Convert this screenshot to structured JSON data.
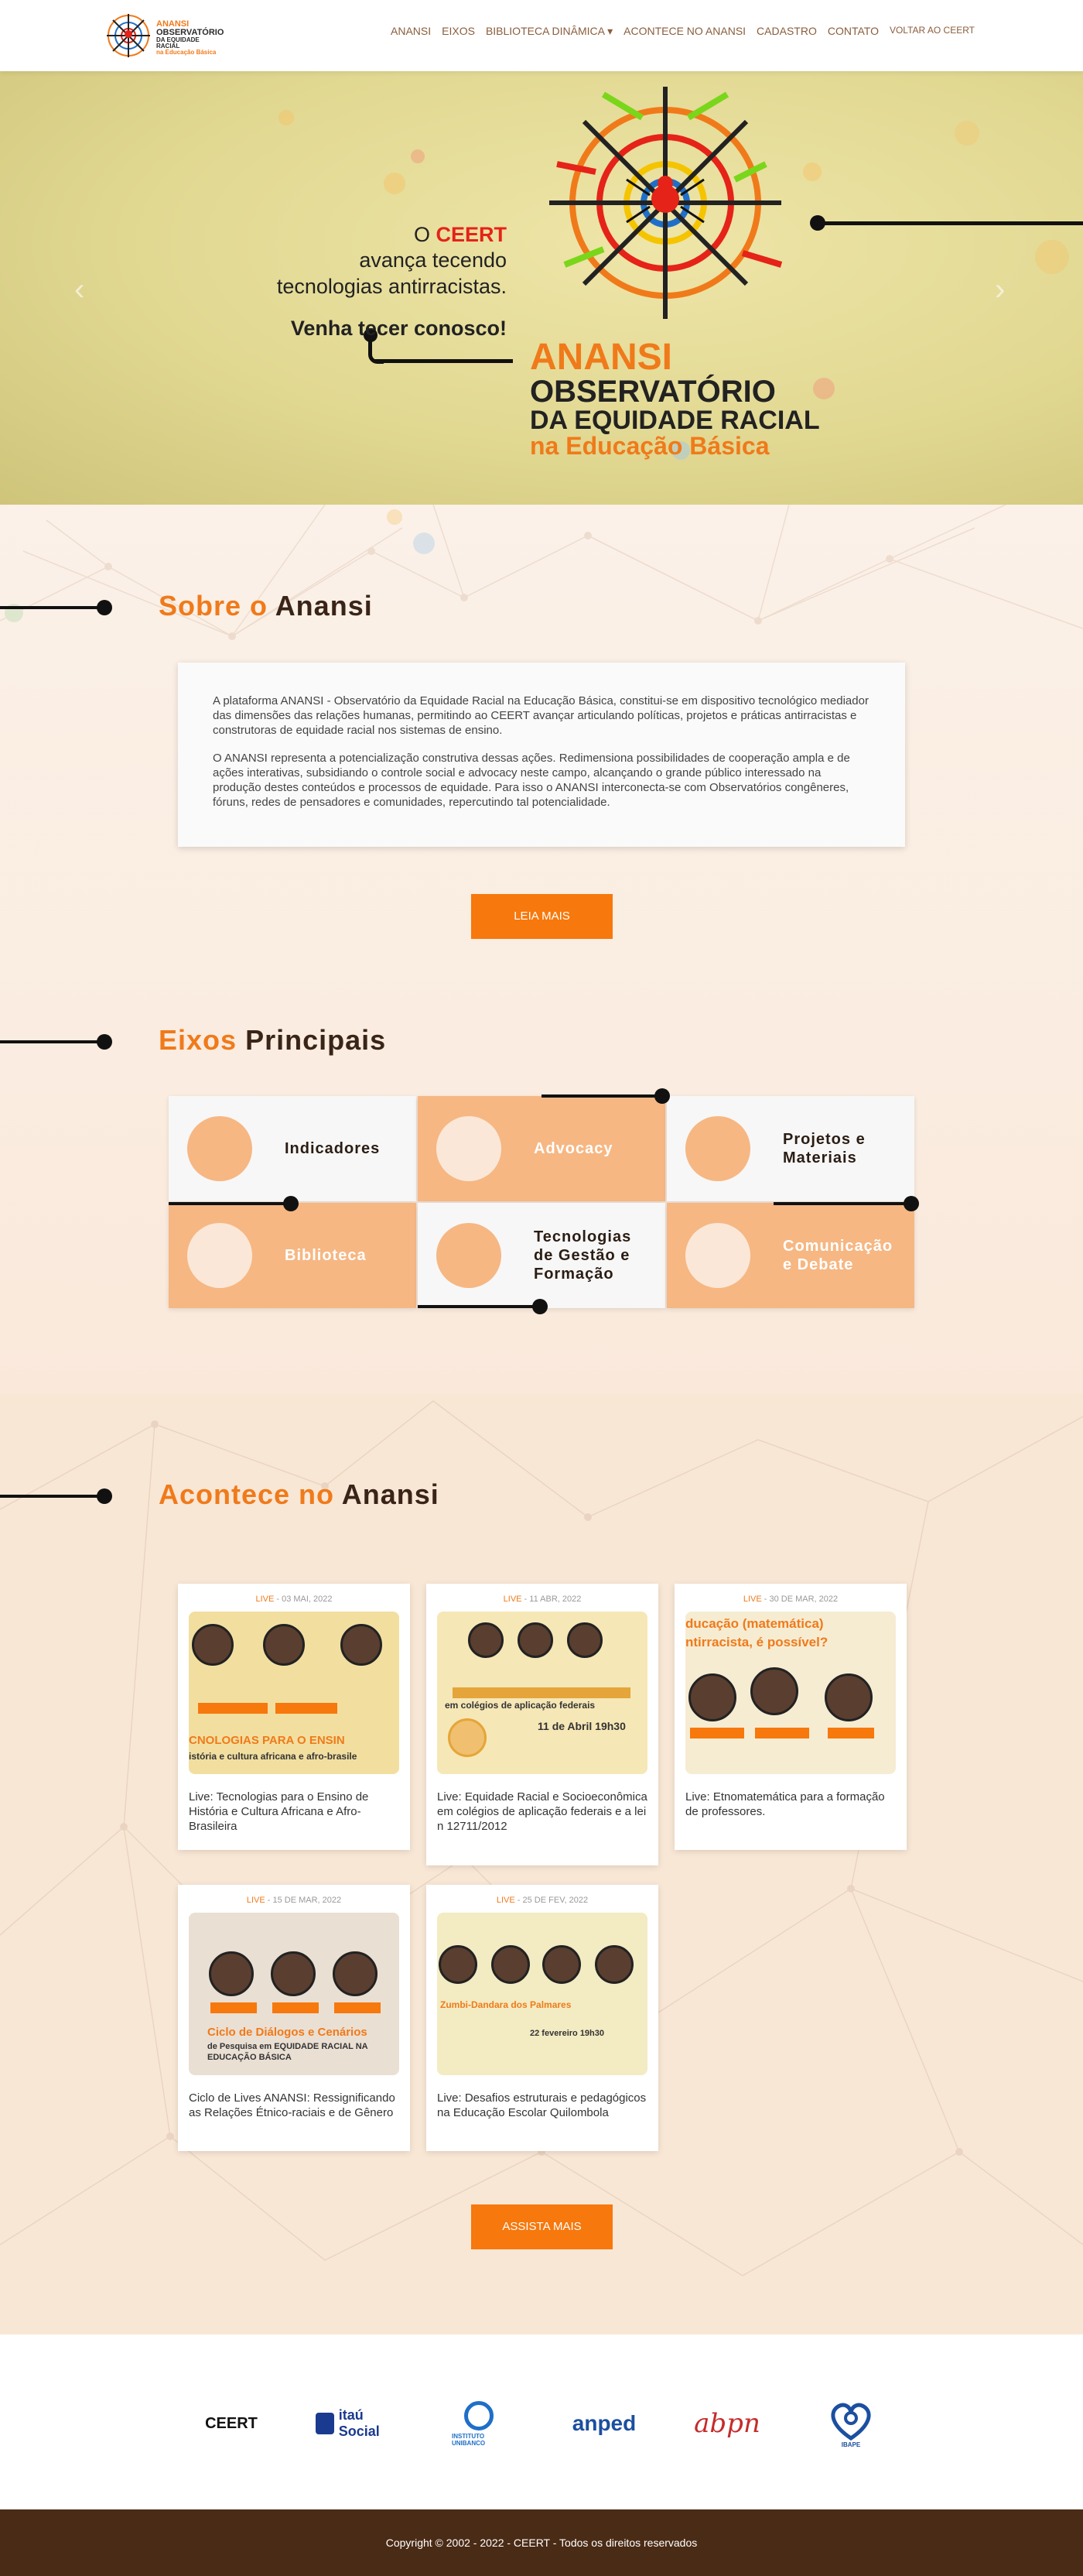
{
  "brand": {
    "line1": "ANANSI",
    "line2": "OBSERVATÓRIO",
    "line3": "DA EQUIDADE RACIAL",
    "line4": "na Educação Básica"
  },
  "nav": [
    {
      "label": "ANANSI"
    },
    {
      "label": "EIXOS"
    },
    {
      "label": "BIBLIOTECA DINÂMICA ▾"
    },
    {
      "label": "ACONTECE NO ANANSI"
    },
    {
      "label": "CADASTRO"
    },
    {
      "label": "CONTATO"
    },
    {
      "label": "VOLTAR AO CEERT"
    }
  ],
  "hero": {
    "line1_pre": "O ",
    "line1_brand": "CEERT",
    "line2": "avança tecendo",
    "line3": "tecnologias antirracistas.",
    "line4": "Venha tecer conosco!",
    "title1": "ANANSI",
    "title2": "OBSERVATÓRIO",
    "title3": "DA EQUIDADE RACIAL",
    "title4": "na Educação Básica",
    "prev_icon": "chevron-left-icon",
    "next_icon": "chevron-right-icon"
  },
  "about": {
    "title_accent": "Sobre o",
    "title_dark": "Anansi",
    "p1": "A plataforma ANANSI - Observatório da Equidade Racial na Educação Básica, constitui-se em dispositivo tecnológico mediador das dimensões das relações humanas, permitindo ao CEERT avançar articulando políticas, projetos e práticas antirracistas e construtoras de equidade racial nos sistemas de ensino.",
    "p2": "O ANANSI representa a potencialização construtiva dessas ações. Redimensiona possibilidades de cooperação ampla e de ações interativas, subsidiando o controle social e advocacy neste campo, alcançando o grande público interessado na produção destes conteúdos e processos de equidade. Para isso o ANANSI interconecta-se com Observatórios congêneres, fóruns, redes de pensadores e comunidades, repercutindo tal potencialidade.",
    "button": "LEIA MAIS"
  },
  "axes": {
    "title_accent": "Eixos",
    "title_dark": "Principais",
    "items": [
      {
        "label": "Indicadores"
      },
      {
        "label": "Advocacy"
      },
      {
        "label": "Projetos e Materiais"
      },
      {
        "label": "Biblioteca"
      },
      {
        "label": "Tecnologias de Gestão e Formação"
      },
      {
        "label": "Comunicação e Debate"
      }
    ]
  },
  "news": {
    "title_accent": "Acontece no",
    "title_dark": "Anansi",
    "button": "ASSISTA MAIS",
    "cards": [
      {
        "tag": "LIVE",
        "date": " - 03 MAI, 2022",
        "title": "Live: Tecnologias para o Ensino de História e Cultura Africana e Afro-Brasileira",
        "thumb_banner": "CNOLOGIAS PARA O ENSIN",
        "thumb_sub": "istória e cultura africana e afro-brasile"
      },
      {
        "tag": "LIVE",
        "date": " - 11 ABR, 2022",
        "title": "Live: Equidade Racial e Socioeconômica em colégios de aplicação federais e a lei n 12711/2012",
        "thumb_banner": "em colégios de aplicação federais",
        "thumb_sub": "11 de Abril 19h30"
      },
      {
        "tag": "LIVE",
        "date": " - 30 DE MAR, 2022",
        "title": "Live: Etnomatemática para a formação de professores.",
        "thumb_banner": "ducação (matemática)",
        "thumb_sub": "ntirracista, é possível?"
      },
      {
        "tag": "LIVE",
        "date": " - 15 DE MAR, 2022",
        "title": "Ciclo de Lives ANANSI: Ressignificando as Relações Étnico-raciais e de Gênero",
        "thumb_banner": "Ciclo de Diálogos e Cenários",
        "thumb_sub": "de Pesquisa em EQUIDADE RACIAL NA EDUCAÇÃO BÁSICA"
      },
      {
        "tag": "LIVE",
        "date": " - 25 DE FEV, 2022",
        "title": "Live: Desafios estruturais e pedagógicos na Educação Escolar Quilombola",
        "thumb_banner": "Zumbi-Dandara dos Palmares",
        "thumb_sub": "22 fevereiro 19h30"
      }
    ]
  },
  "partners": [
    {
      "name": "CEERT"
    },
    {
      "name": "itaú Social"
    },
    {
      "name": "INSTITUTO UNIBANCO"
    },
    {
      "name": "anped"
    },
    {
      "name": "abpn"
    },
    {
      "name": "IBAPE"
    }
  ],
  "footer": {
    "text": "Copyright © 2002 - 2022 - CEERT - Todos os direitos reservados"
  },
  "colors": {
    "accent": "#f7780c",
    "dark_brown": "#4a2b16",
    "tile_orange": "#f6b783"
  }
}
